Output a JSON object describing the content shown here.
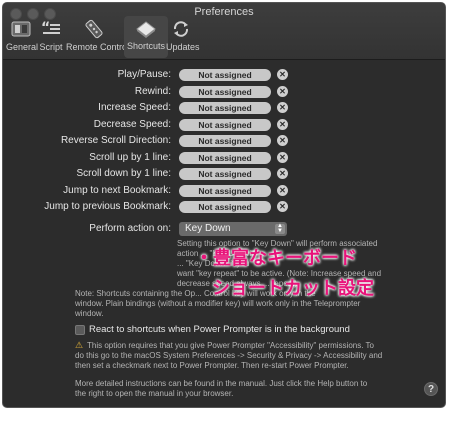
{
  "window": {
    "title": "Preferences"
  },
  "toolbar": {
    "items": [
      {
        "label": "General"
      },
      {
        "label": "Script"
      },
      {
        "label": "Remote Control"
      },
      {
        "label": "Shortcuts"
      },
      {
        "label": "Updates"
      }
    ]
  },
  "shortcuts": [
    {
      "label": "Play/Pause:",
      "value": "Not assigned"
    },
    {
      "label": "Rewind:",
      "value": "Not assigned"
    },
    {
      "label": "Increase Speed:",
      "value": "Not assigned"
    },
    {
      "label": "Decrease Speed:",
      "value": "Not assigned"
    },
    {
      "label": "Reverse Scroll Direction:",
      "value": "Not assigned"
    },
    {
      "label": "Scroll up by 1 line:",
      "value": "Not assigned"
    },
    {
      "label": "Scroll down by 1 line:",
      "value": "Not assigned"
    },
    {
      "label": "Jump to next Bookmark:",
      "value": "Not assigned"
    },
    {
      "label": "Jump to previous Bookmark:",
      "value": "Not assigned"
    }
  ],
  "perform_action": {
    "label": "Perform action on:",
    "value": "Key Down",
    "help_lines": [
      "Setting this option to \"Key Down\" will perform associated",
      "action ... \"Key Up\" will",
      "... \"Key Down\" if you",
      "want \"key repeat\" to be active. (Note: Increase speed and",
      "decrease speed always ... repeat)"
    ]
  },
  "note_lines": [
    "Note: Shortcuts containing the Op... Control key will work only in the",
    "window. Plain bindings (without a modifier key) will work only in the Teleprompter",
    "window."
  ],
  "background_option": {
    "label": "React to shortcuts when Power Prompter is in the background",
    "checked": false
  },
  "accessibility_lines": [
    "This option requires that you give Power Prompter \"Accessibility\" permissions. To",
    "do this go to the macOS System Preferences -> Security & Privacy -> Accessibility and",
    "then set a checkmark next to Power Prompter. Then re-start Power Prompter."
  ],
  "manual_lines": [
    "More detailed instructions can be found in the manual. Just click the Help button to",
    "the right to open the manual in your browser."
  ],
  "help_button": "?",
  "overlay": {
    "line1": "・豊富なキーボード",
    "line2": "ショートカット設定"
  },
  "colors": {
    "window_bg": "#2c2c2c",
    "overlay_text": "#e8137a",
    "key_field_bg": "#c8c8c8"
  }
}
